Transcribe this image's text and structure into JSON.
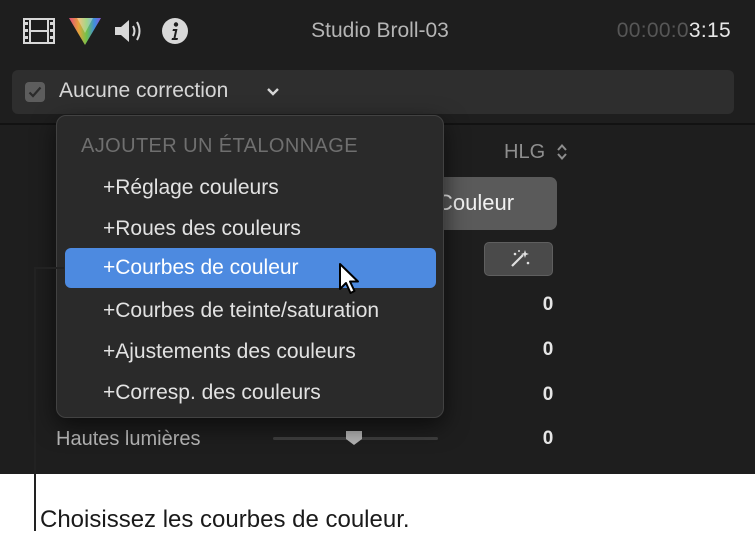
{
  "header": {
    "icons": [
      "film-icon",
      "color-prism-icon",
      "speaker-icon",
      "info-icon"
    ],
    "clip_title": "Studio Broll-03",
    "timecode_dim": "00:00:0",
    "timecode_bright": "3:15"
  },
  "correction": {
    "checked": true,
    "label": "Aucune correction"
  },
  "inspector": {
    "color_space": "HLG",
    "big_button_label": "Couleur",
    "values": [
      "0",
      "0",
      "0",
      "0"
    ],
    "highlights_label": "Hautes lumières"
  },
  "menu": {
    "header": "AJOUTER UN ÉTALONNAGE",
    "items": [
      {
        "label": "+Réglage couleurs",
        "selected": false
      },
      {
        "label": "+Roues des couleurs",
        "selected": false
      },
      {
        "label": "+Courbes de couleur",
        "selected": true
      },
      {
        "label": "+Courbes de teinte/saturation",
        "selected": false
      },
      {
        "label": "+Ajustements des couleurs",
        "selected": false
      },
      {
        "label": "+Corresp. des couleurs",
        "selected": false
      }
    ]
  },
  "caption": "Choisissez les courbes de couleur.",
  "colors": {
    "panel_bg": "#1e1e1e",
    "menu_bg": "#2a2a2a",
    "selection": "#4d8ae0",
    "caption_text": "#1a1a1a"
  }
}
